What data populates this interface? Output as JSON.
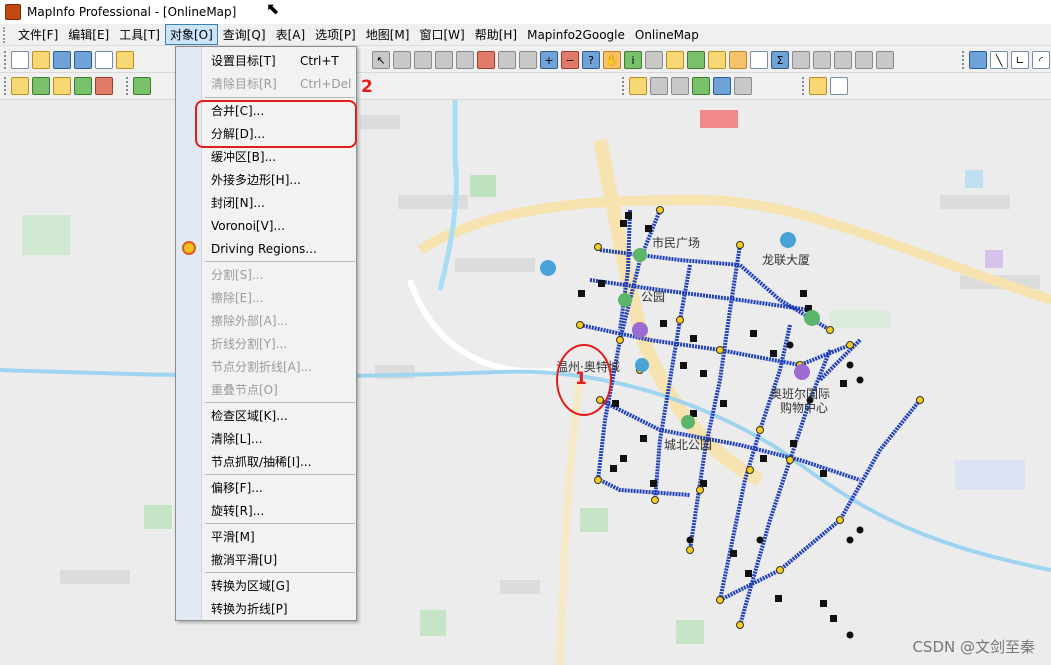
{
  "window": {
    "title": "MapInfo Professional - [OnlineMap]"
  },
  "menubar": {
    "items": [
      "文件[F]",
      "编辑[E]",
      "工具[T]",
      "对象[O]",
      "查询[Q]",
      "表[A]",
      "选项[P]",
      "地图[M]",
      "窗口[W]",
      "帮助[H]",
      "Mapinfo2Google",
      "OnlineMap"
    ],
    "active_index": 3
  },
  "object_menu": {
    "set_target": {
      "label": "设置目标[T]",
      "shortcut": "Ctrl+T"
    },
    "clear_target": {
      "label": "清除目标[R]",
      "shortcut": "Ctrl+Del"
    },
    "combine": "合并[C]...",
    "disaggregate": "分解[D]...",
    "buffer": "缓冲区[B]...",
    "convex_hull": "外接多边形[H]...",
    "enclose": "封闭[N]...",
    "voronoi": "Voronoi[V]...",
    "driving_regions": "Driving Regions...",
    "split": "分割[S]...",
    "erase": "擦除[E]...",
    "erase_outside": "擦除外部[A]...",
    "split_polyline": "折线分割[Y]...",
    "split_at_node": "节点分割折线[A]...",
    "overlay_nodes": "重叠节点[O]",
    "check_regions": "检查区域[K]...",
    "clean": "清除[L]...",
    "snap_thin": "节点抓取/抽稀[I]...",
    "offset": "偏移[F]...",
    "rotate": "旋转[R]...",
    "smooth": "平滑[M]",
    "unsmooth": "撤消平滑[U]",
    "convert_region": "转换为区域[G]",
    "convert_polyline": "转换为折线[P]"
  },
  "map": {
    "labels": {
      "civic_square": "市民广场",
      "longlian": "龙联大厦",
      "park": "公园",
      "outlets": "温州·奥特城",
      "olympic": "奥班尔国际",
      "shopping": "购物中心",
      "chengbei": "城北公园"
    }
  },
  "annotations": {
    "label_1": "1",
    "label_2": "2"
  },
  "watermark": "CSDN @文剑至秦",
  "colors": {
    "route": "#1f3fb8",
    "annotation": "#e31c1c",
    "menu_highlight": "#cce4f7"
  }
}
